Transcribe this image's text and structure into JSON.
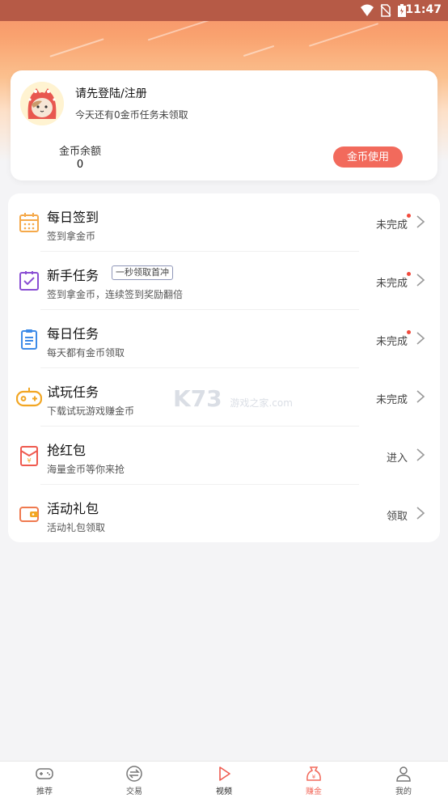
{
  "status_bar": {
    "time": "11:47"
  },
  "user": {
    "login_prompt": "请先登陆/注册",
    "task_hint": "今天还有0金币任务未领取",
    "balance_label": "金币余额",
    "balance_value": "0",
    "use_button": "金币使用"
  },
  "tasks": [
    {
      "title": "每日签到",
      "desc": "签到拿金币",
      "status": "未完成",
      "icon": "calendar-icon",
      "badge": ""
    },
    {
      "title": "新手任务",
      "desc": "签到拿金币，连续签到奖励翻倍",
      "status": "未完成",
      "icon": "checkbox-icon",
      "badge": "一秒领取首冲"
    },
    {
      "title": "每日任务",
      "desc": "每天都有金币领取",
      "status": "未完成",
      "icon": "clipboard-icon",
      "badge": ""
    },
    {
      "title": "试玩任务",
      "desc": "下载试玩游戏赚金币",
      "status": "未完成",
      "icon": "gamepad-icon",
      "badge": ""
    },
    {
      "title": "抢红包",
      "desc": "海量金币等你来抢",
      "status": "进入",
      "icon": "red-envelope-icon",
      "badge": ""
    },
    {
      "title": "活动礼包",
      "desc": "活动礼包领取",
      "status": "领取",
      "icon": "wallet-icon",
      "badge": ""
    }
  ],
  "watermark": {
    "main": "K73",
    "sub": "游戏之家",
    "domain": ".com"
  },
  "bottom_nav": [
    {
      "label": "推荐",
      "icon": "gamepad-icon",
      "active": false
    },
    {
      "label": "交易",
      "icon": "exchange-icon",
      "active": false
    },
    {
      "label": "视频",
      "icon": "play-icon",
      "active": false
    },
    {
      "label": "赚金",
      "icon": "money-bag-icon",
      "active": true
    },
    {
      "label": "我的",
      "icon": "user-icon",
      "active": false
    }
  ],
  "colors": {
    "accent": "#f26a5c",
    "hero_top": "#f7916a",
    "status_bar": "#b65a46"
  }
}
